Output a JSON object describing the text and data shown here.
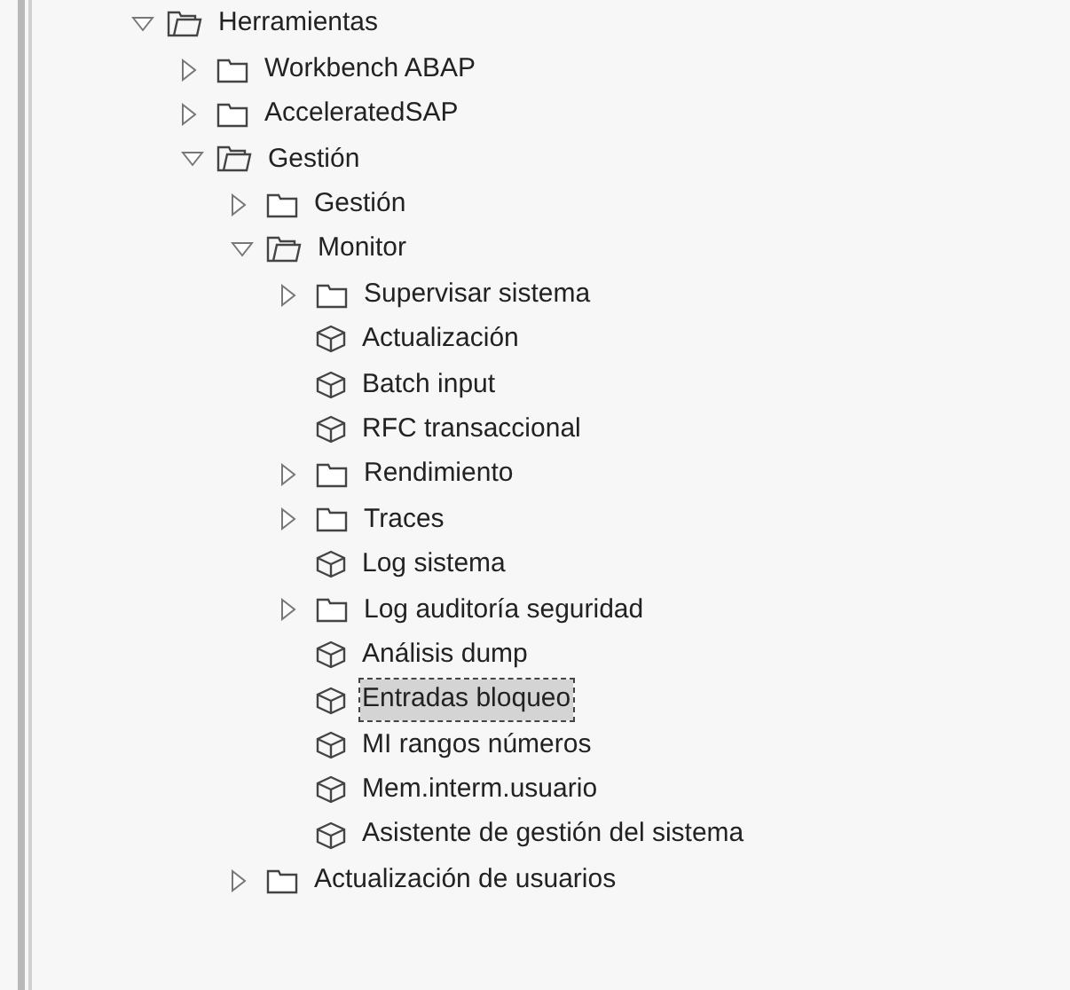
{
  "tree": [
    {
      "label": "Herramientas",
      "kind": "folder",
      "expanded": true,
      "selected": false,
      "children": [
        {
          "label": "Workbench ABAP",
          "kind": "folder",
          "expanded": false,
          "selected": false
        },
        {
          "label": "AcceleratedSAP",
          "kind": "folder",
          "expanded": false,
          "selected": false
        },
        {
          "label": "Gestión",
          "kind": "folder",
          "expanded": true,
          "selected": false,
          "children": [
            {
              "label": "Gestión",
              "kind": "folder",
              "expanded": false,
              "selected": false
            },
            {
              "label": "Monitor",
              "kind": "folder",
              "expanded": true,
              "selected": false,
              "children": [
                {
                  "label": "Supervisar sistema",
                  "kind": "folder",
                  "expanded": false,
                  "selected": false
                },
                {
                  "label": "Actualización",
                  "kind": "leaf",
                  "selected": false
                },
                {
                  "label": "Batch input",
                  "kind": "leaf",
                  "selected": false
                },
                {
                  "label": "RFC transaccional",
                  "kind": "leaf",
                  "selected": false
                },
                {
                  "label": "Rendimiento",
                  "kind": "folder",
                  "expanded": false,
                  "selected": false
                },
                {
                  "label": "Traces",
                  "kind": "folder",
                  "expanded": false,
                  "selected": false
                },
                {
                  "label": "Log sistema",
                  "kind": "leaf",
                  "selected": false
                },
                {
                  "label": "Log auditoría seguridad",
                  "kind": "folder",
                  "expanded": false,
                  "selected": false
                },
                {
                  "label": "Análisis dump",
                  "kind": "leaf",
                  "selected": false
                },
                {
                  "label": "Entradas bloqueo",
                  "kind": "leaf",
                  "selected": true
                },
                {
                  "label": "MI rangos números",
                  "kind": "leaf",
                  "selected": false
                },
                {
                  "label": "Mem.interm.usuario",
                  "kind": "leaf",
                  "selected": false
                },
                {
                  "label": "Asistente de gestión del sistema",
                  "kind": "leaf",
                  "selected": false
                }
              ]
            },
            {
              "label": "Actualización de usuarios",
              "kind": "folder",
              "expanded": false,
              "selected": false
            }
          ]
        }
      ]
    }
  ]
}
